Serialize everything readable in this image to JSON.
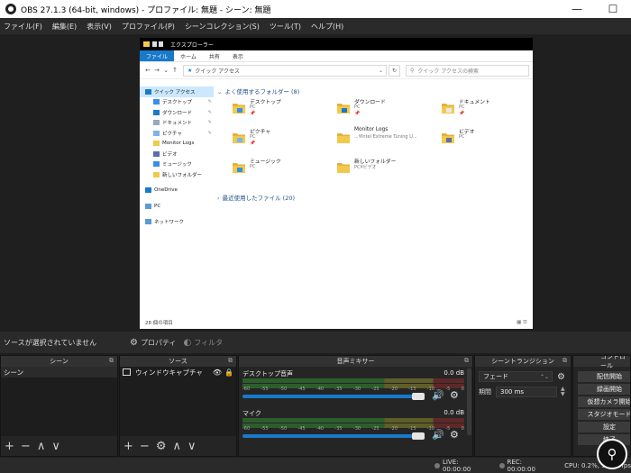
{
  "window": {
    "title": "OBS 27.1.3 (64-bit, windows) - プロファイル: 無題 - シーン: 無題",
    "minimize": "—",
    "close": "☐"
  },
  "menu": [
    "ファイル(F)",
    "編集(E)",
    "表示(V)",
    "プロファイル(P)",
    "シーンコレクション(S)",
    "ツール(T)",
    "ヘルプ(H)"
  ],
  "explorer": {
    "title": "エクスプローラー",
    "tabs": [
      "ファイル",
      "ホーム",
      "共有",
      "表示"
    ],
    "address": "クイック アクセス",
    "search_placeholder": "クイック アクセスの検索",
    "nav_items": [
      {
        "label": "クイック アクセス",
        "kind": "sel",
        "icon": "star"
      },
      {
        "label": "デスクトップ",
        "kind": "sub",
        "icon": "desktop",
        "pin": true
      },
      {
        "label": "ダウンロード",
        "kind": "sub",
        "icon": "download",
        "pin": true
      },
      {
        "label": "ドキュメント",
        "kind": "sub",
        "icon": "document",
        "pin": true
      },
      {
        "label": "ピクチャ",
        "kind": "sub",
        "icon": "picture",
        "pin": true
      },
      {
        "label": "Monitor Logs",
        "kind": "sub",
        "icon": "folder"
      },
      {
        "label": "ビデオ",
        "kind": "sub",
        "icon": "video"
      },
      {
        "label": "ミュージック",
        "kind": "sub",
        "icon": "music"
      },
      {
        "label": "新しいフォルダー",
        "kind": "sub",
        "icon": "folder"
      },
      {
        "label": "",
        "kind": "gap"
      },
      {
        "label": "OneDrive",
        "kind": "top",
        "icon": "cloud"
      },
      {
        "label": "",
        "kind": "gap"
      },
      {
        "label": "PC",
        "kind": "top",
        "icon": "pc"
      },
      {
        "label": "",
        "kind": "gap"
      },
      {
        "label": "ネットワーク",
        "kind": "top",
        "icon": "network"
      }
    ],
    "frequent_title": "よく使用するフォルダー (8)",
    "folders": [
      {
        "name": "デスクトップ",
        "sub": "PC",
        "pin": "📌",
        "type": "desktop"
      },
      {
        "name": "ダウンロード",
        "sub": "PC",
        "pin": "📌",
        "type": "download"
      },
      {
        "name": "ドキュメント",
        "sub": "PC",
        "pin": "📌",
        "type": "document"
      },
      {
        "name": "ピクチャ",
        "sub": "PC",
        "pin": "📌",
        "type": "picture"
      },
      {
        "name": "Monitor Logs",
        "sub": "...¥Intel Extreme Tuning U...",
        "pin": "",
        "type": "plain"
      },
      {
        "name": "ビデオ",
        "sub": "PC",
        "pin": "",
        "type": "video"
      },
      {
        "name": "ミュージック",
        "sub": "PC",
        "pin": "",
        "type": "music"
      },
      {
        "name": "新しいフォルダー",
        "sub": "PC¥ビデオ",
        "pin": "",
        "type": "plain"
      }
    ],
    "recent_title": "最近使用したファイル (20)",
    "status": "28 個の項目"
  },
  "source_bar": {
    "no_source": "ソースが選択されていません",
    "properties": "プロパティ",
    "filters": "フィルタ"
  },
  "docks": {
    "scenes": {
      "title": "シーン",
      "items": [
        "シーン"
      ]
    },
    "sources": {
      "title": "ソース",
      "items": [
        "ウィンドウキャプチャ"
      ]
    },
    "mixer": {
      "title": "音声ミキサー",
      "tracks": [
        {
          "name": "デスクトップ音声",
          "db": "0.0 dB",
          "level": 0.84
        },
        {
          "name": "マイク",
          "db": "0.0 dB",
          "level": 0.84
        }
      ],
      "scale": [
        "-60",
        "-55",
        "-50",
        "-45",
        "-40",
        "-35",
        "-30",
        "-25",
        "-20",
        "-15",
        "-10",
        "-5",
        "0"
      ]
    },
    "transitions": {
      "title": "シーントランジション",
      "selected": "フェード",
      "duration_label": "期間",
      "duration_value": "300 ms"
    },
    "controls": {
      "title": "コントロール",
      "buttons": [
        "配信開始",
        "録画開始",
        "仮想カメラ開始",
        "スタジオモード",
        "設定",
        "終了"
      ]
    }
  },
  "statusbar": {
    "live": "LIVE: 00:00:00",
    "rec": "REC: 00:00:00",
    "cpu": "CPU: 0.2%, 30.00 fps"
  },
  "icons": {
    "float": "⧉",
    "add": "+",
    "remove": "−",
    "up": "∧",
    "down": "∨",
    "gear": "⚙",
    "eye": "👁",
    "lock": "🔒",
    "speaker": "🔊",
    "zoom": "⚲"
  },
  "colors": {
    "accent": "#1979ca",
    "folder": "#f2c94c",
    "obs_bg": "#1f1f1f"
  }
}
